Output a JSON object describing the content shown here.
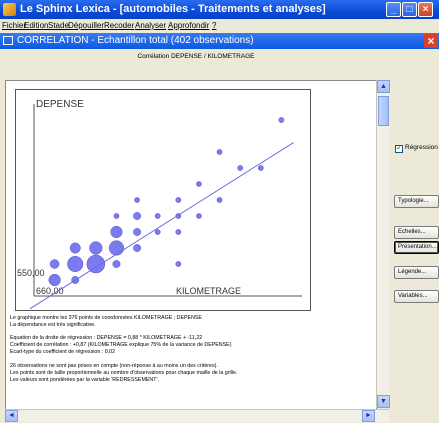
{
  "app": {
    "title": "Le Sphinx Lexica - [automobiles - Traitements et analyses]",
    "min_symbol": "_",
    "max_symbol": "□",
    "close_symbol": "×"
  },
  "menu": [
    "Fichier",
    "Edition",
    "Stade",
    "Dépouiller",
    "Recoder",
    "Analyser",
    "Approfondir",
    "?"
  ],
  "child_window": {
    "title": "CORRELATION - Echantillon total (402 observations)",
    "close_symbol": "×"
  },
  "chart_header": "Corrélation DEPENSE / KILOMETRAGE",
  "chart_data": {
    "type": "scatter",
    "ylabel": "DEPENSE",
    "xlabel": "KILOMETRAGE",
    "x_min_label": "660,00",
    "y_min_label": "550,00",
    "regression": {
      "slope": 0.88,
      "intercept": -11.22
    },
    "points": [
      {
        "x": 1,
        "y": 1,
        "n": 5
      },
      {
        "x": 2,
        "y": 1,
        "n": 2
      },
      {
        "x": 1,
        "y": 2,
        "n": 3
      },
      {
        "x": 2,
        "y": 2,
        "n": 9
      },
      {
        "x": 3,
        "y": 2,
        "n": 12
      },
      {
        "x": 4,
        "y": 2,
        "n": 2
      },
      {
        "x": 2,
        "y": 3,
        "n": 4
      },
      {
        "x": 3,
        "y": 3,
        "n": 6
      },
      {
        "x": 4,
        "y": 3,
        "n": 8
      },
      {
        "x": 5,
        "y": 3,
        "n": 2
      },
      {
        "x": 4,
        "y": 4,
        "n": 5
      },
      {
        "x": 5,
        "y": 4,
        "n": 2
      },
      {
        "x": 6,
        "y": 4,
        "n": 1
      },
      {
        "x": 7,
        "y": 4,
        "n": 1
      },
      {
        "x": 4,
        "y": 5,
        "n": 1
      },
      {
        "x": 5,
        "y": 5,
        "n": 2
      },
      {
        "x": 6,
        "y": 5,
        "n": 1
      },
      {
        "x": 7,
        "y": 5,
        "n": 1
      },
      {
        "x": 8,
        "y": 5,
        "n": 1
      },
      {
        "x": 5,
        "y": 6,
        "n": 1
      },
      {
        "x": 7,
        "y": 6,
        "n": 1
      },
      {
        "x": 9,
        "y": 6,
        "n": 1
      },
      {
        "x": 8,
        "y": 7,
        "n": 1
      },
      {
        "x": 11,
        "y": 8,
        "n": 1
      },
      {
        "x": 7,
        "y": 2,
        "n": 1
      },
      {
        "x": 10,
        "y": 8,
        "n": 1
      },
      {
        "x": 9,
        "y": 9,
        "n": 1
      },
      {
        "x": 12,
        "y": 11,
        "n": 1
      }
    ],
    "x_range": [
      0,
      13
    ],
    "y_range": [
      0,
      12
    ],
    "colors": {
      "bubble": "#7b7bef",
      "bubble_stroke": "#5252c8",
      "line": "#6a6aeb"
    }
  },
  "info": {
    "line1": "Le graphique montre les 376 points de coordonnées KILOMETRAGE ; DEPENSE",
    "line2": "La dépendance est très significative.",
    "line3": "Equation de la droite de régression : DEPENSE = 0,88 * KILOMETRAGE + -11,22",
    "line4": "Coefficient de corrélation : +0,87 (KILOMETRAGE explique 75% de la variance de DEPENSE)",
    "line5": "Ecart-type du coefficient de régression : 0,02",
    "line6": "26 observations ne sont pas prises en compte (non-réponse à au moins un des critères).",
    "line7": "Les points sont de taille proportionnelle au nombre d'observations pour chaque maille de la grille.",
    "line8": "Les valeurs sont pondérées par la variable 'REDRESSEMENT'."
  },
  "side": {
    "regression_label": "Régression",
    "regression_checked": true,
    "buttons": [
      "Typologie...",
      "Echelles...",
      "Présentation...",
      "Légende...",
      "Variables..."
    ]
  },
  "scroll": {
    "up": "▲",
    "down": "▼",
    "left": "◄",
    "right": "►"
  }
}
